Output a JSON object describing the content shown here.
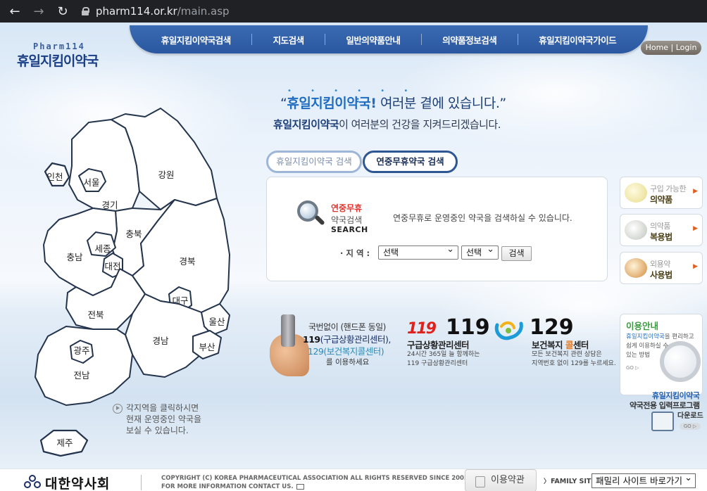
{
  "browser": {
    "url_host": "pharm114.or.kr",
    "url_path": "/main.asp"
  },
  "logo": {
    "sub": "Pharm114",
    "main": "휴일지킴이약국"
  },
  "nav": {
    "items": [
      "휴일지킴이약국검색",
      "지도검색",
      "일반의약품안내",
      "의약품정보검색",
      "휴일지킴이약국가이드"
    ],
    "home_login": "Home | Login"
  },
  "hero": {
    "dots": "• • • • • •",
    "quote_open": "“",
    "brand": "휴일지킴이약국",
    "bang": "!",
    "rest": "여러분 곁에 있습니다.",
    "quote_close": "”",
    "sub_brand": "휴일지킴이약국",
    "sub_rest": "이 여러분의 건강을 지켜드리겠습니다."
  },
  "search": {
    "tabs": [
      "휴일지킴이약국 검색",
      "연중무휴약국 검색"
    ],
    "title_red": "연중무휴",
    "title_gray": "약국검색",
    "title_en": "SEARCH",
    "description": "연중무휴로 운영중인 약국을 검색하실 수 있습니다.",
    "region_label": "· 지 역 :",
    "select1_value": "선택",
    "select2_value": "선택",
    "button": "검색"
  },
  "side": {
    "items": [
      {
        "line1": "구입 가능한",
        "line2": "의약품"
      },
      {
        "line1": "의약품",
        "line2": "복용법"
      },
      {
        "line1": "외용약",
        "line2": "사용법"
      }
    ],
    "arrow": "▶"
  },
  "emergency": {
    "line1": "국번없이 (핸드폰 동일)",
    "line2_num": "119",
    "line2_rest": "(구급상황관리센터),",
    "line3": "129(보건복지콜센터)",
    "line4": "를 이용하세요",
    "logo119": "119",
    "num119": "119",
    "title119": "구급상황관리센터",
    "desc119_1": "24시간 365일 늘 함께하는",
    "desc119_2": "119 구급상황관리센터",
    "num129": "129",
    "title129_a": "보건복지 ",
    "title129_hl": "콜",
    "title129_b": "센터",
    "desc129_1": "모든 보건복지 관련 상담은",
    "desc129_2": "지역번호 없이 129를 누르세요."
  },
  "guide": {
    "heading": "이용안내",
    "desc_hl": "휴일지킴이약국",
    "desc_rest": "을 편리하고\n쉽게 이용하실 수\n있는 방법",
    "go": "GO ▷"
  },
  "download": {
    "line1": "휴일지킴이약국",
    "line2": "약국전용 입력프로그램",
    "line3": "다운로드",
    "go": "GO ▷"
  },
  "map": {
    "regions": [
      "인천",
      "서울",
      "경기",
      "강원",
      "충북",
      "충남",
      "세종",
      "대전",
      "경북",
      "대구",
      "전북",
      "울산",
      "경남",
      "부산",
      "광주",
      "전남",
      "제주"
    ],
    "hint": "각지역을 클릭하시면\n현재 운영중인 약국을\n보실 수 있습니다."
  },
  "footer": {
    "org": "대한약사회",
    "copyright1": "COPYRIGHT (C) KOREA PHARMACEUTICAL ASSOCIATION ALL RIGHTS RESERVED SINCE 2005",
    "copyright2": "FOR MORE INFORMATION CONTACT US.",
    "terms": "이용약관",
    "family_label": "FAMILY SITE",
    "family_select": "패밀리 사이트 바로가기"
  }
}
